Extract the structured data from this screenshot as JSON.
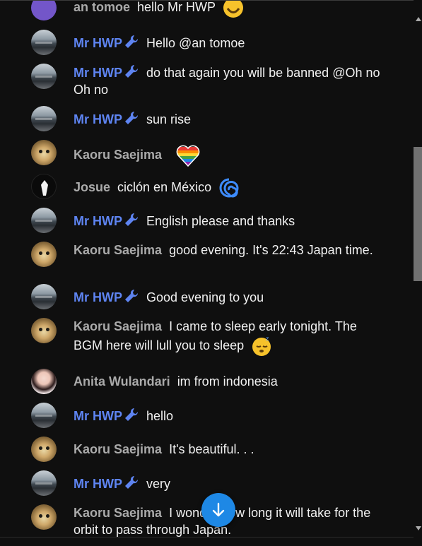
{
  "messages": [
    {
      "author": "an tomoe",
      "text": "hello Mr HWP",
      "role": "user",
      "avatar": "purple",
      "emoji": "smile"
    },
    {
      "author": "Mr HWP",
      "text": "Hello @an tomoe",
      "role": "moderator",
      "avatar": "landscape"
    },
    {
      "author": "Mr HWP",
      "text": "do that again you will be banned @Oh no Oh no",
      "role": "moderator",
      "avatar": "landscape"
    },
    {
      "author": "Mr HWP",
      "text": "sun rise",
      "role": "moderator",
      "avatar": "landscape"
    },
    {
      "author": "Kaoru Saejima",
      "text": "",
      "role": "user",
      "avatar": "cat",
      "emoji": "rainbow-heart"
    },
    {
      "author": "Josue",
      "text": "ciclón en México",
      "role": "user",
      "avatar": "tux",
      "emoji": "cyclone"
    },
    {
      "author": "Mr HWP",
      "text": "English please and thanks",
      "role": "moderator",
      "avatar": "landscape"
    },
    {
      "author": "Kaoru Saejima",
      "text": "good evening. It's 22:43 Japan time.",
      "role": "user",
      "avatar": "cat"
    },
    {
      "author": "Mr HWP",
      "text": "Good evening to you",
      "role": "moderator",
      "avatar": "landscape"
    },
    {
      "author": "Kaoru Saejima",
      "text": "I came to sleep early tonight. The BGM here will lull you to sleep",
      "role": "user",
      "avatar": "cat",
      "emoji": "sleeping-face"
    },
    {
      "author": "Anita Wulandari",
      "text": "im from indonesia",
      "role": "user",
      "avatar": "girl"
    },
    {
      "author": "Mr HWP",
      "text": "hello",
      "role": "moderator",
      "avatar": "landscape"
    },
    {
      "author": "Kaoru Saejima",
      "text": "It's beautiful. . .",
      "role": "user",
      "avatar": "cat"
    },
    {
      "author": "Mr HWP",
      "text": "very",
      "role": "moderator",
      "avatar": "landscape"
    },
    {
      "author": "Kaoru Saejima",
      "text": "I wonder how long it will take for the orbit to pass through Japan.",
      "role": "user",
      "avatar": "cat"
    }
  ],
  "colors": {
    "moderator": "#5e84f1",
    "user": "#aaaaaa",
    "background": "#0f0f0f",
    "jump_button": "#1e88e5"
  },
  "icons": {
    "moderator_badge": "wrench-icon",
    "jump": "arrow-down-icon"
  }
}
